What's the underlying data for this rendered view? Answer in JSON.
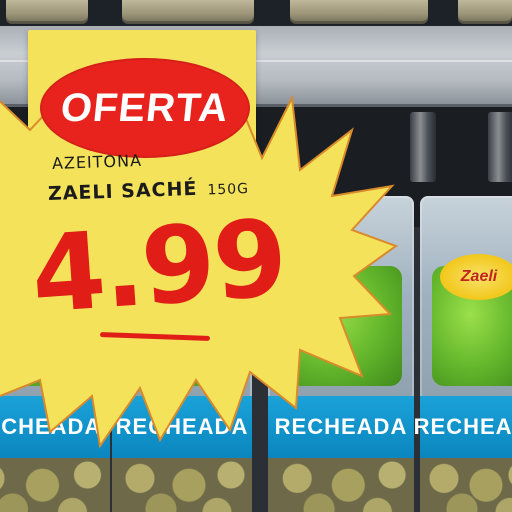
{
  "sign": {
    "banner": "OFERTA",
    "product_line1": "AZEITONA",
    "product_line2_name": "ZAELI SACHÉ",
    "product_line2_size": "150G",
    "price": "4.99"
  },
  "packages": {
    "band_labels": [
      "RECHEADA",
      "RECHEADA",
      "RECHEADA",
      "RECHEADA"
    ],
    "brand_badge": "Zaeli"
  },
  "colors": {
    "sign_yellow": "#f4e35a",
    "banner_red": "#e8231d",
    "price_red": "#e01d17",
    "band_blue": "#0b86bf",
    "sachet_green": "#62b52b"
  }
}
